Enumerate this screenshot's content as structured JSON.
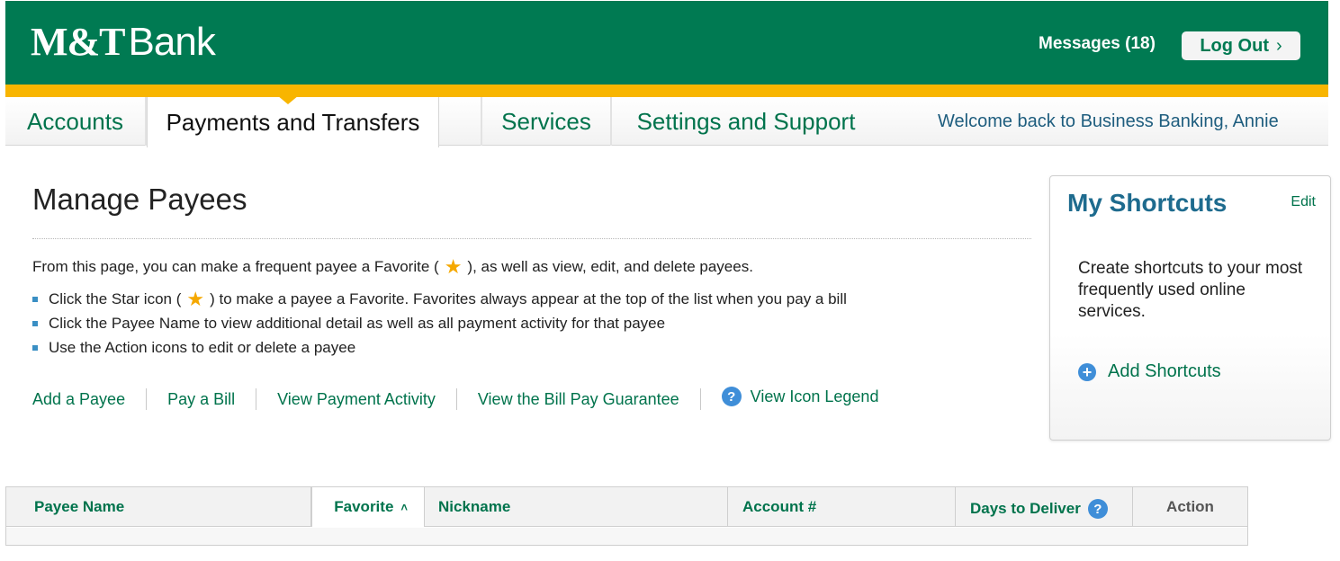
{
  "header": {
    "logo_mt": "M&T",
    "logo_bank": "Bank",
    "messages": "Messages (18)",
    "logout_label": "Log Out"
  },
  "nav": {
    "tabs": [
      {
        "label": "Accounts"
      },
      {
        "label": "Payments and Transfers",
        "active": true
      },
      {
        "label": "Services"
      },
      {
        "label": "Settings and Support"
      }
    ],
    "welcome": "Welcome back to Business Banking, Annie"
  },
  "main": {
    "title": "Manage Payees",
    "intro_before": "From this page, you can make a frequent payee a Favorite (",
    "intro_after": "), as well as view, edit, and delete payees.",
    "bullets": [
      {
        "before": "Click the Star icon (",
        "after": ") to make a payee a Favorite. Favorites always appear at the top of the list when you pay a bill"
      },
      {
        "text": "Click the Payee Name to view additional detail as well as all payment activity for that payee"
      },
      {
        "text": "Use the Action icons to edit or delete a payee"
      }
    ],
    "links": [
      "Add a Payee",
      "Pay a Bill",
      "View Payment Activity",
      "View the Bill Pay Guarantee",
      "View Icon Legend"
    ]
  },
  "shortcuts": {
    "title": "My Shortcuts",
    "edit": "Edit",
    "text": "Create shortcuts to your most frequently used online services.",
    "add": "Add Shortcuts"
  },
  "table": {
    "headers": [
      "Payee Name",
      "Favorite",
      "Nickname",
      "Account #",
      "Days to Deliver",
      "Action"
    ]
  },
  "colors": {
    "brand_green": "#007a52",
    "accent_yellow": "#f8b500",
    "link_green": "#00734c",
    "title_blue": "#1e6b8e",
    "icon_blue": "#3f8ed8"
  },
  "icons": {
    "star": "star-icon",
    "help": "question-circle-icon",
    "plus": "plus-circle-icon",
    "chevron": "chevron-right-icon",
    "caret": "caret-up-icon"
  }
}
